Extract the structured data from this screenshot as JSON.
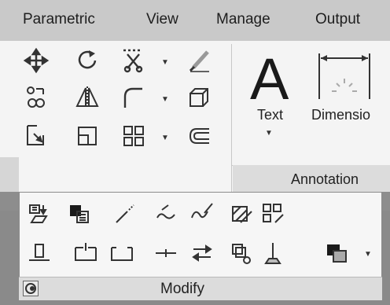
{
  "menu": {
    "items": [
      "Parametric",
      "View",
      "Manage",
      "Output"
    ]
  },
  "panels": {
    "annotation": {
      "label": "Annotation",
      "text_button": "Text",
      "dimension_button": "Dimensio"
    },
    "modify": {
      "label": "Modify"
    }
  },
  "icons": {
    "draw_tools": [
      "move-icon",
      "rotate-icon",
      "trim-icon",
      "erase-icon",
      "copy-icon",
      "mirror-icon",
      "fillet-icon",
      "explode-icon",
      "stretch-icon",
      "scale-icon",
      "array-icon",
      "offset-icon"
    ],
    "modify_row1": [
      "matchprop-icon",
      "changeproperties-icon",
      "lengthen-icon",
      "editpolyline-icon",
      "editspline-icon",
      "edithatch-icon",
      "editarray-icon"
    ],
    "modify_row2": [
      "aligntop-icon",
      "break-at-point-icon",
      "break-icon",
      "join-icon",
      "reverse-icon",
      "setbylayer-icon",
      "changespace-icon",
      "draworder-icon"
    ]
  },
  "colors": {
    "menubar": "#c9c9c9",
    "panel_bg": "#f4f4f4",
    "footer_bg": "#dcdcdc",
    "icon": "#333333",
    "accent_dark": "#1a1a1a"
  }
}
